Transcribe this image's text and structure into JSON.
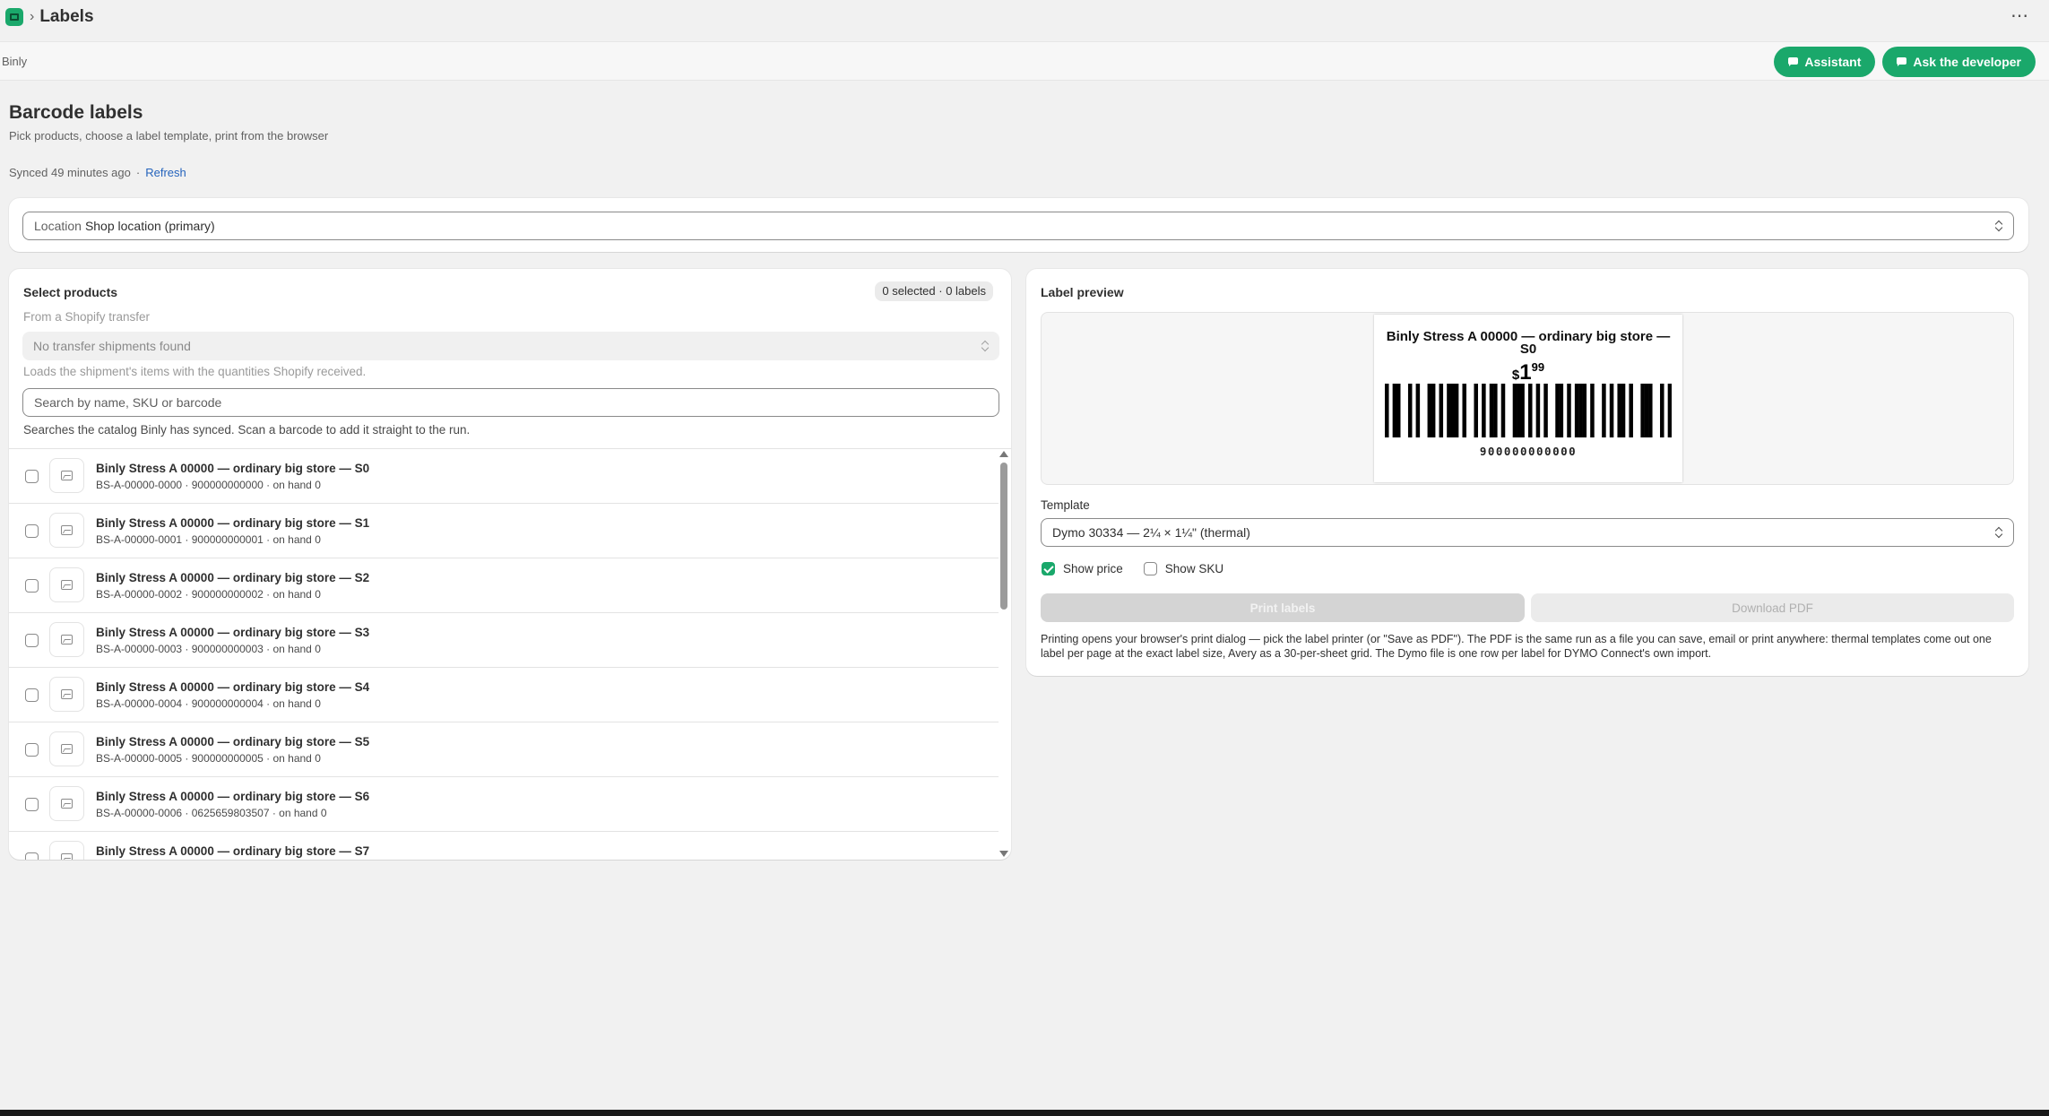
{
  "topbar": {
    "page": "Labels",
    "more_label": "⋯"
  },
  "appbar": {
    "app_name": "Binly",
    "assistant_label": "Assistant",
    "developer_label": "Ask the developer"
  },
  "header": {
    "title": "Barcode labels",
    "subtitle": "Pick products, choose a label template, print from the browser",
    "synced": "Synced 49 minutes ago",
    "separator": "·",
    "refresh": "Refresh"
  },
  "location": {
    "prefix": "Location",
    "value": "Shop location (primary)"
  },
  "products": {
    "title": "Select products",
    "badge": "0 selected · 0 labels",
    "transfer_label": "From a Shopify transfer",
    "transfer_value": "No transfer shipments found",
    "transfer_help": "Loads the shipment's items with the quantities Shopify received.",
    "search_placeholder": "Search by name, SKU or barcode",
    "search_help": "Searches the catalog Binly has synced. Scan a barcode to add it straight to the run.",
    "items": [
      {
        "name": "Binly Stress A 00000 — ordinary big store — S0",
        "meta": "BS-A-00000-0000 · 900000000000 · on hand 0"
      },
      {
        "name": "Binly Stress A 00000 — ordinary big store — S1",
        "meta": "BS-A-00000-0001 · 900000000001 · on hand 0"
      },
      {
        "name": "Binly Stress A 00000 — ordinary big store — S2",
        "meta": "BS-A-00000-0002 · 900000000002 · on hand 0"
      },
      {
        "name": "Binly Stress A 00000 — ordinary big store — S3",
        "meta": "BS-A-00000-0003 · 900000000003 · on hand 0"
      },
      {
        "name": "Binly Stress A 00000 — ordinary big store — S4",
        "meta": "BS-A-00000-0004 · 900000000004 · on hand 0"
      },
      {
        "name": "Binly Stress A 00000 — ordinary big store — S5",
        "meta": "BS-A-00000-0005 · 900000000005 · on hand 0"
      },
      {
        "name": "Binly Stress A 00000 — ordinary big store — S6",
        "meta": "BS-A-00000-0006 · 0625659803507 · on hand 0"
      },
      {
        "name": "Binly Stress A 00000 — ordinary big store — S7",
        "meta": ""
      }
    ]
  },
  "preview": {
    "title": "Label preview",
    "label_name": "Binly Stress A 00000 — ordinary big store — S0",
    "price_symbol": "$",
    "price_major": "1",
    "price_minor": "99",
    "barcode_digits": "900000000000",
    "template_label": "Template",
    "template_value": "Dymo 30334 — 2¼ × 1¼\" (thermal)",
    "show_price_label": "Show price",
    "show_price": true,
    "show_sku_label": "Show SKU",
    "show_sku": false,
    "print_label": "Print labels",
    "pdf_label": "Download PDF",
    "note": "Printing opens your browser's print dialog — pick the label printer (or \"Save as PDF\"). The PDF is the same run as a file you can save, email or print anywhere: thermal templates come out one label per page at the exact label size, Avery as a 30-per-sheet grid. The Dymo file is one row per label for DYMO Connect's own import."
  },
  "colors": {
    "accent": "#1aa86b",
    "link": "#2463bc"
  }
}
